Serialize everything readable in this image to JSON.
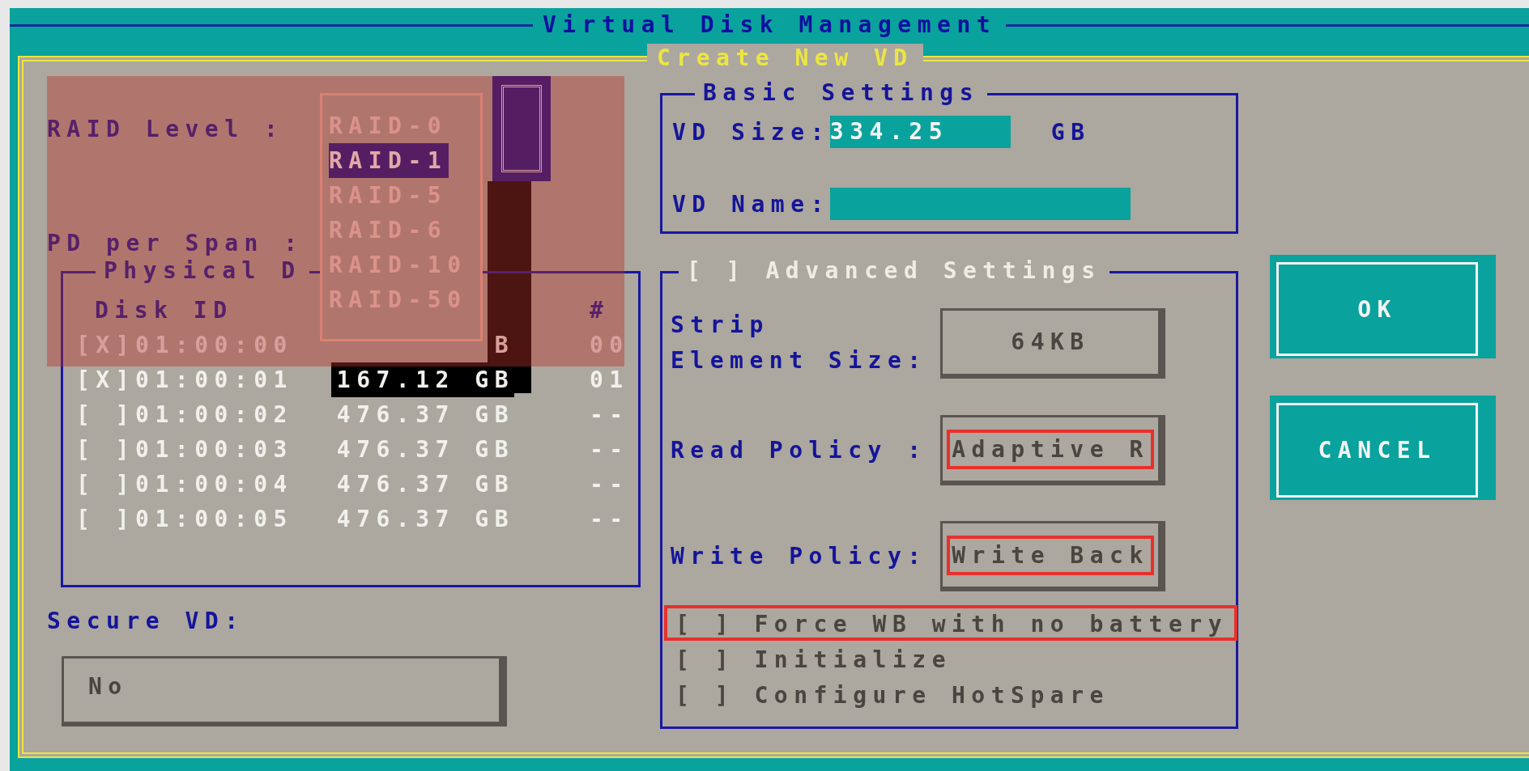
{
  "window": {
    "title": "Virtual Disk Management"
  },
  "dialog": {
    "title": "Create New VD"
  },
  "raid_level": {
    "label": "RAID Level :",
    "options": [
      {
        "label": "RAID-0",
        "selected": false
      },
      {
        "label": "RAID-1",
        "selected": true
      },
      {
        "label": "RAID-5",
        "selected": false
      },
      {
        "label": "RAID-6",
        "selected": false
      },
      {
        "label": "RAID-10",
        "selected": false
      },
      {
        "label": "RAID-50",
        "selected": false
      }
    ]
  },
  "pd_per_span": {
    "label": "PD per Span :"
  },
  "physical_disks": {
    "title": "Physical D",
    "columns": [
      "Disk ID",
      "#"
    ],
    "rows": [
      {
        "disk_id": "[X]01:00:00",
        "size": "B",
        "number": "00",
        "focused": false
      },
      {
        "disk_id": "[X]01:00:01",
        "size": "167.12 GB",
        "number": "01",
        "focused": true
      },
      {
        "disk_id": "[ ]01:00:02",
        "size": "476.37 GB",
        "number": "--",
        "focused": false
      },
      {
        "disk_id": "[ ]01:00:03",
        "size": "476.37 GB",
        "number": "--",
        "focused": false
      },
      {
        "disk_id": "[ ]01:00:04",
        "size": "476.37 GB",
        "number": "--",
        "focused": false
      },
      {
        "disk_id": "[ ]01:00:05",
        "size": "476.37 GB",
        "number": "--",
        "focused": false
      }
    ]
  },
  "secure_vd": {
    "label": "Secure VD:",
    "value": "No"
  },
  "basic_settings": {
    "title": "Basic Settings",
    "vd_size": {
      "label": "VD Size:",
      "value": "334.25",
      "unit": "GB"
    },
    "vd_name": {
      "label": "VD Name:"
    }
  },
  "advanced_settings": {
    "title": "[ ] Advanced Settings",
    "fields": [
      {
        "label": "Strip\nElement Size:",
        "value": "64KB",
        "annotated": false
      },
      {
        "label": "Read Policy :",
        "value": "Adaptive R",
        "annotated": true
      },
      {
        "label": "Write Policy:",
        "value": "Write Back",
        "annotated": true
      }
    ],
    "options": [
      {
        "label": "[ ] Force WB with no battery",
        "annotated": true
      },
      {
        "label": "[ ] Initialize",
        "annotated": false
      },
      {
        "label": "[ ] Configure HotSpare",
        "annotated": false
      }
    ]
  },
  "buttons": [
    {
      "label": "OK"
    },
    {
      "label": "CANCEL"
    }
  ]
}
